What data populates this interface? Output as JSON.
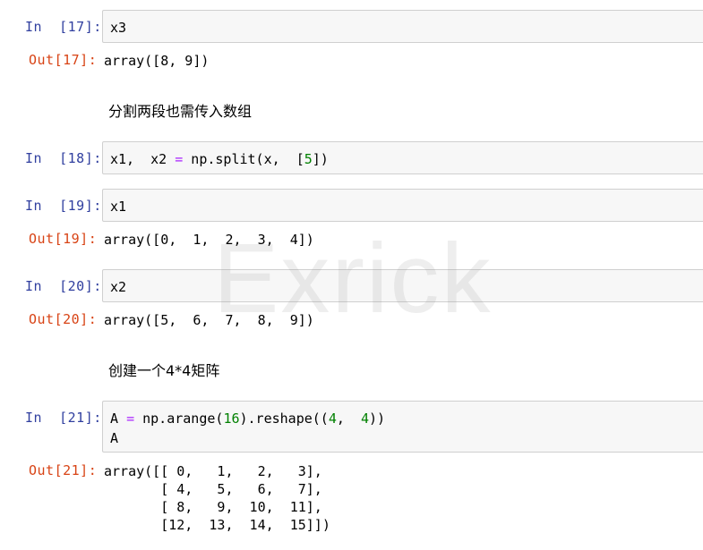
{
  "cells": [
    {
      "in": "In  [17]:",
      "code": "x3",
      "out": "Out[17]:",
      "output": "array([8, 9])"
    },
    {
      "md": "分割两段也需传入数组"
    },
    {
      "in": "In  [18]:",
      "code_parts": [
        "x1,  x2 ",
        "=",
        " np.split(x,  [",
        "5",
        "])"
      ]
    },
    {
      "in": "In  [19]:",
      "code": "x1",
      "out": "Out[19]:",
      "output": "array([0,  1,  2,  3,  4])"
    },
    {
      "in": "In  [20]:",
      "code": "x2",
      "out": "Out[20]:",
      "output": "array([5,  6,  7,  8,  9])"
    },
    {
      "md": "创建一个4*4矩阵"
    },
    {
      "in": "In  [21]:",
      "code_parts": [
        "A ",
        "=",
        " np.arange(",
        "16",
        ").reshape((",
        "4",
        ",  ",
        "4",
        "))"
      ],
      "code_line2": "A",
      "out": "Out[21]:",
      "output_lines": [
        "array([[ 0,   1,   2,   3],",
        "       [ 4,   5,   6,   7],",
        "       [ 8,   9,  10,  11],",
        "       [12,  13,  14,  15]])"
      ]
    }
  ],
  "watermark": "Exrick"
}
